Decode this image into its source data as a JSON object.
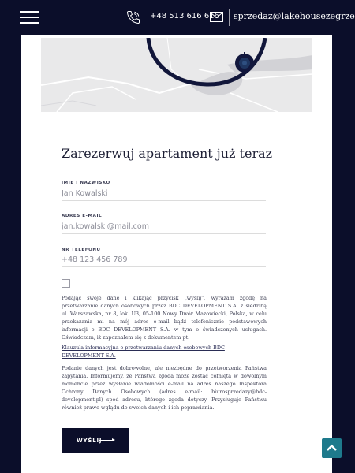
{
  "header": {
    "phone": "+48 513 616 616",
    "email": "sprzedaz@lakehousezegrze.pl"
  },
  "form": {
    "title": "Zarezerwuj apartament już teraz",
    "fields": [
      {
        "label": "IMIĘ I NAZWISKO",
        "placeholder": "Jan Kowalski"
      },
      {
        "label": "ADRES E-MAIL",
        "placeholder": "jan.kowalski@mail.com"
      },
      {
        "label": "NR TELEFONU",
        "placeholder": "+48 123 456 789"
      }
    ],
    "consent": "Podając swoje dane i klikając przycisk „wyślij”, wyrażam zgodę na przetwarzanie danych osobowych przez BDC DEVELOPMENT S.A. z siedzibą ul. Warszawska, nr 8, lok. U3, 05-100 Nowy Dwór Mazowiecki, Polska, w celu przekazania mi na mój adres e-mail bądź telefonicznie podstawowych informacji o BDC DEVELOPMENT S.A. w tym o świadczonych usługach. Oświadczam, iż zapoznałem się z dokumentem pt.",
    "clause_link": "Klauzula informacyjna o przetwarzaniu danych osobowych BDC DEVELOPMENT S.A.",
    "info": "Podanie danych jest dobrowolne, ale niezbędne do przetworzenia Państwa zapytania. Informujemy, że Państwa zgoda może zostać cofnięta w dowolnym momencie przez wysłanie wiadomości e-mail na adres naszego Inspektora Ochrony Danych Osobowych (adres e-mail: biurosprzedazy@bdc-development.pl) spod adresu, którego zgoda dotyczy. Przysługuje Państwu również prawo wglądu do swoich danych i ich poprawiania.",
    "submit_label": "WYŚLIJ"
  },
  "icons": {
    "menu": "hamburger-icon",
    "phone": "phone-icon",
    "mail": "mail-icon",
    "scroll_top": "chevron-up-icon",
    "map_marker": "map-pin-icon"
  },
  "colors": {
    "header_bg": "#0b0e2a",
    "accent": "#1e7a8c",
    "button_bg": "#0b0e2a"
  }
}
